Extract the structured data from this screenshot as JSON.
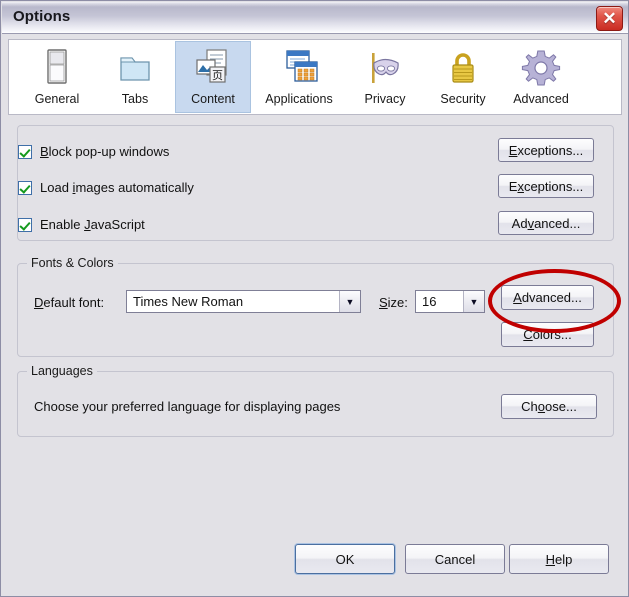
{
  "window": {
    "title": "Options",
    "close_icon": "close-icon",
    "close_glyph": "✕"
  },
  "tabs": [
    {
      "label": "General",
      "icon": "window-pane-icon",
      "selected": false
    },
    {
      "label": "Tabs",
      "icon": "folder-tabs-icon",
      "selected": false
    },
    {
      "label": "Content",
      "icon": "content-page-icon",
      "selected": true
    },
    {
      "label": "Applications",
      "icon": "app-windows-icon",
      "selected": false
    },
    {
      "label": "Privacy",
      "icon": "mask-icon",
      "selected": false
    },
    {
      "label": "Security",
      "icon": "padlock-icon",
      "selected": false
    },
    {
      "label": "Advanced",
      "icon": "gear-icon",
      "selected": false
    }
  ],
  "content_group": {
    "checkboxes": [
      {
        "label_pre": "B",
        "label_post": "lock pop-up windows",
        "checked": true
      },
      {
        "label_pre": "",
        "label_post": "Load images automatically",
        "checked": true
      },
      {
        "label_pre": "",
        "label_post": "Enable JavaScript",
        "checked": true
      }
    ],
    "checkbox_labels": [
      "Block pop-up windows",
      "Load images automatically",
      "Enable JavaScript"
    ],
    "buttons": [
      {
        "label": "Exceptions...",
        "accesskey": "E"
      },
      {
        "label": "Exceptions...",
        "accesskey": "x"
      },
      {
        "label": "Advanced...",
        "accesskey": "v"
      }
    ]
  },
  "fonts_group": {
    "legend": "Fonts & Colors",
    "default_font_label": "Default font:",
    "default_font_value": "Times New Roman",
    "size_label": "Size:",
    "size_value": "16",
    "advanced_button": "Advanced...",
    "colors_button": "Colors...",
    "dropdown_icon": "chevron-down-icon"
  },
  "languages_group": {
    "legend": "Languages",
    "description": "Choose your preferred language for displaying pages",
    "choose_button": "Choose..."
  },
  "footer": {
    "ok_label": "OK",
    "cancel_label": "Cancel",
    "help_label": "Help"
  },
  "annotation": {
    "shape": "ellipse",
    "color": "#c00000",
    "targets": "Advanced... button in Fonts & Colors"
  },
  "colors": {
    "dialog_background": "#e2e1e6",
    "selected_tab": "#c8d9ef",
    "checkmark_green": "#159a1e",
    "checkbox_border_blue": "#3f6fa8",
    "close_red": "#c92b22",
    "annotation_red": "#c00000"
  }
}
